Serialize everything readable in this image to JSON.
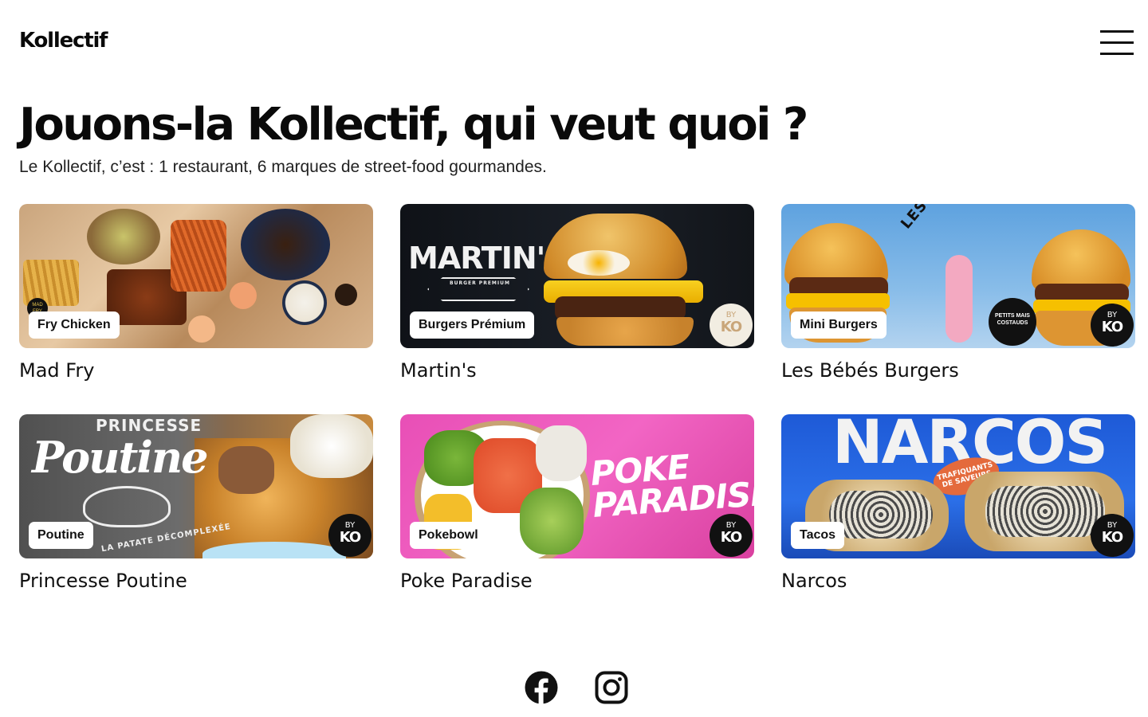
{
  "header": {
    "logo": "Kollectif",
    "menu_icon": "hamburger-menu-icon"
  },
  "hero": {
    "title": "Jouons-la Kollectif, qui veut quoi ?",
    "subtitle": "Le Kollectif, c’est : 1 restaurant, 6 marques de street-food gourmandes."
  },
  "brands": [
    {
      "name": "Mad Fry",
      "tag": "Fry Chicken",
      "badge_small": "MAD FRY",
      "image_text": ""
    },
    {
      "name": "Martin's",
      "tag": "Burgers Prémium",
      "badge_small": "BY",
      "badge_big": "KO",
      "image_text": "MARTIN'S",
      "image_sub": "BURGER PREMIUM"
    },
    {
      "name": "Les Bébés Burgers",
      "tag": "Mini Burgers",
      "badge_small": "BY",
      "badge_big": "KO",
      "image_text": "LES BÉBÉS BURGERS",
      "image_sub": "PETITS MAIS COSTAUDS"
    },
    {
      "name": "Princesse Poutine",
      "tag": "Poutine",
      "badge_small": "BY",
      "badge_big": "KO",
      "image_text": "Poutine",
      "image_top": "PRINCESSE",
      "image_sub": "LA PATATE DÉCOMPLEXÉE"
    },
    {
      "name": "Poke Paradise",
      "tag": "Pokebowl",
      "badge_small": "BY",
      "badge_big": "KO",
      "image_text": "POKE PARADISE"
    },
    {
      "name": "Narcos",
      "tag": "Tacos",
      "badge_small": "BY",
      "badge_big": "KO",
      "image_text": "NARCOS",
      "image_sub": "TRAFIQUANTS DE SAVEURS"
    }
  ],
  "footer": {
    "social": [
      {
        "icon": "facebook-icon"
      },
      {
        "icon": "instagram-icon"
      }
    ]
  },
  "colors": {
    "text": "#111111",
    "background": "#ffffff",
    "tag_bg": "#ffffff",
    "badge_dark": "#111111"
  }
}
